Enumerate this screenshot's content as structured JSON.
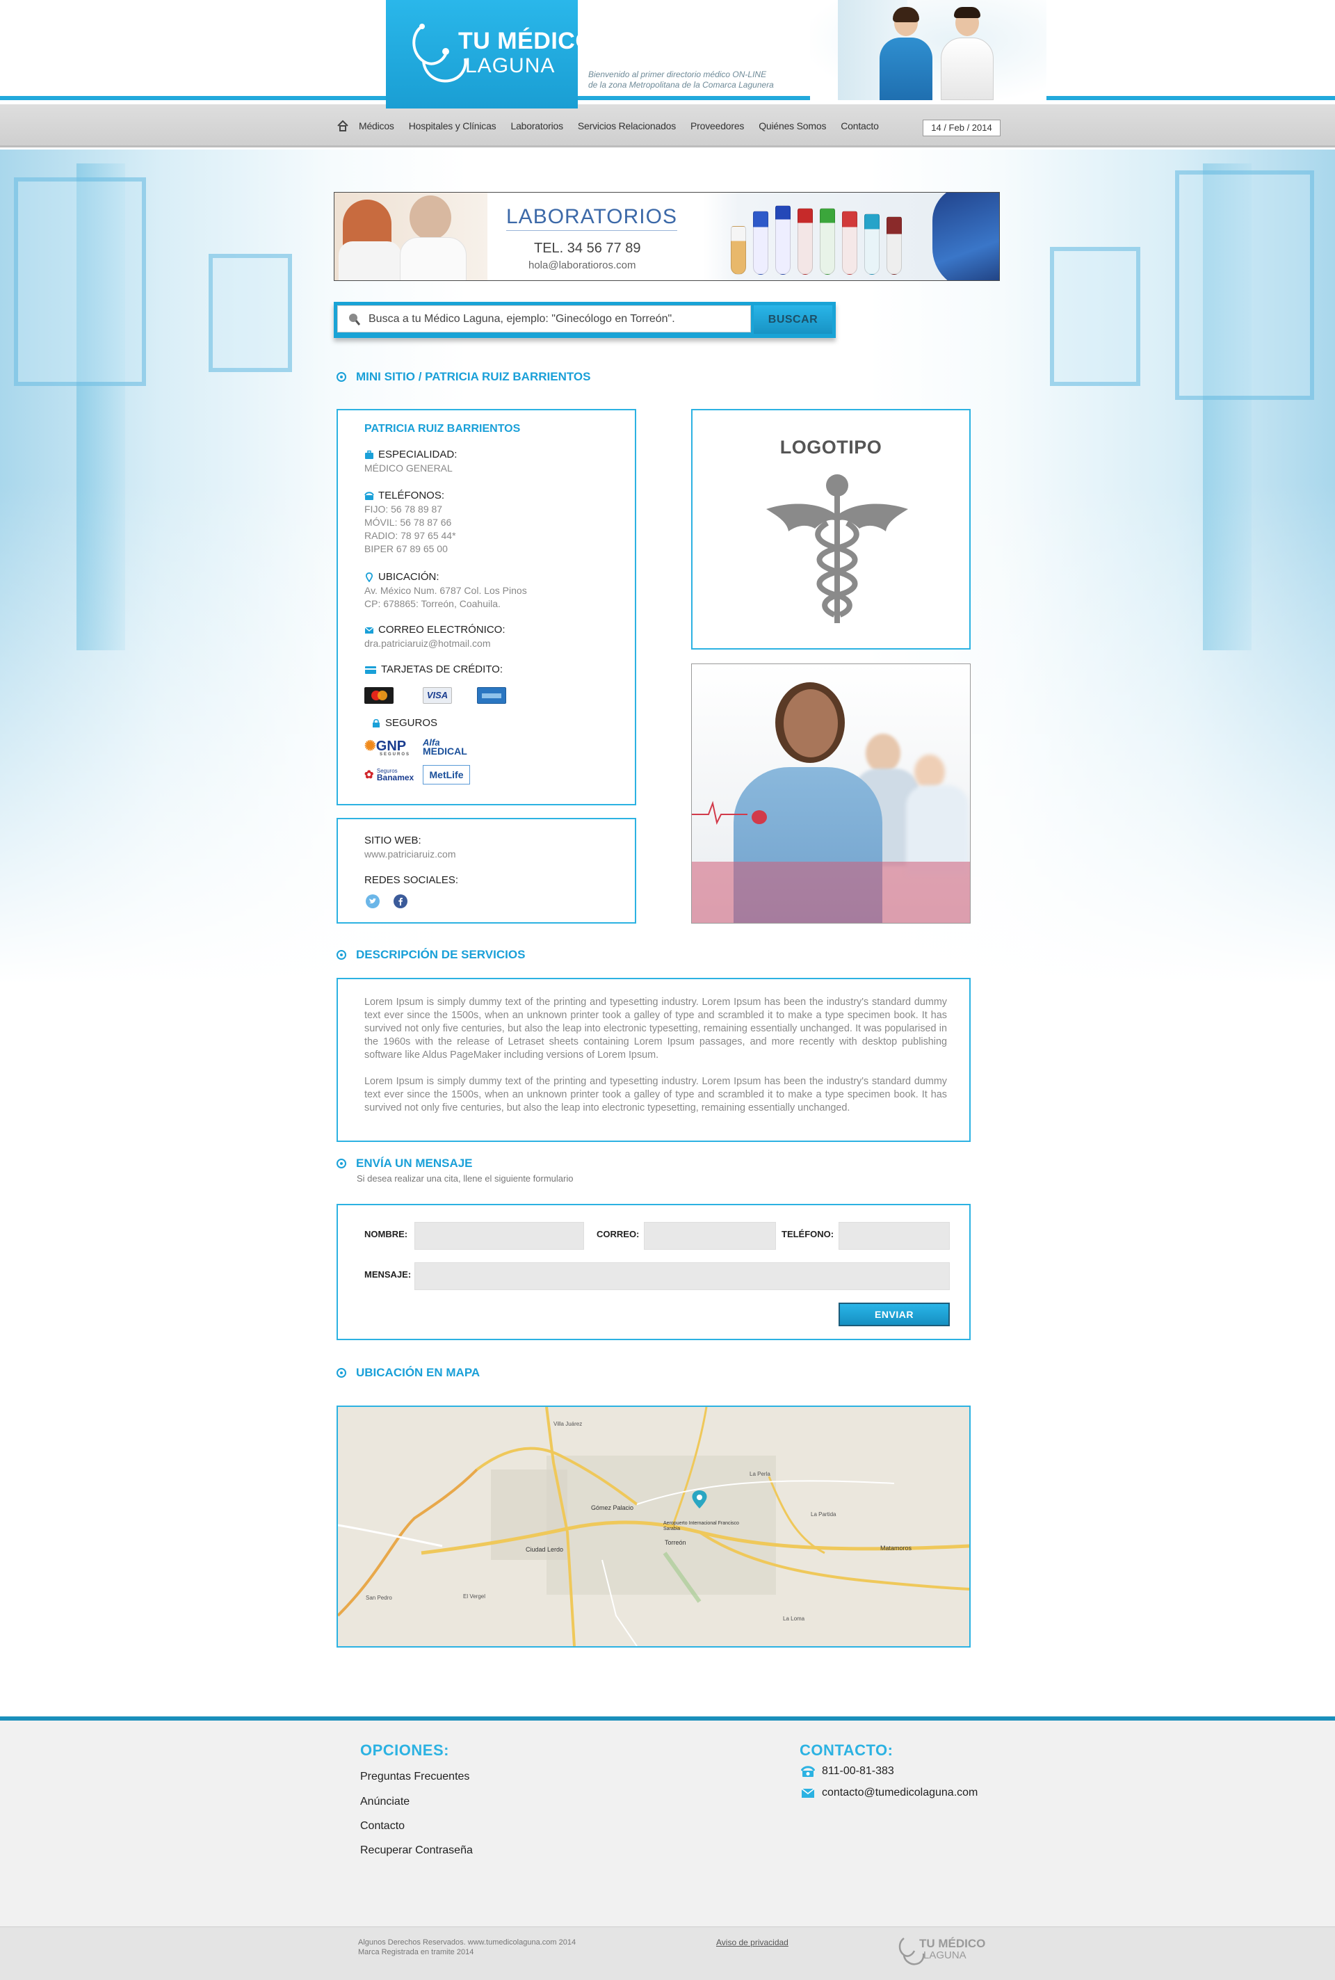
{
  "header": {
    "logo_line1": "TU MÉDICO",
    "logo_line2": "LAGUNA",
    "tagline_line1": "Bienvenido al primer directorio médico ON-LINE",
    "tagline_line2": "de la zona Metropolitana de la Comarca Lagunera",
    "brand_color": "#22a9dc"
  },
  "nav": {
    "home_icon": "home-icon",
    "items": [
      "Médicos",
      "Hospitales y Clínicas",
      "Laboratorios",
      "Servicios Relacionados",
      "Proveedores",
      "Quiénes Somos",
      "Contacto"
    ],
    "date": "14 / Feb / 2014"
  },
  "banner": {
    "title": "LABORATORIOS",
    "tel": "TEL. 34 56 77 89",
    "email": "hola@laboratioros.com"
  },
  "search": {
    "placeholder": "Busca a tu Médico Laguna, ejemplo: \"Ginecólogo en Torreón\".",
    "button": "BUSCAR"
  },
  "minisite": {
    "heading": "MINI SITIO / PATRICIA RUIZ BARRIENTOS",
    "name": "PATRICIA RUIZ BARRIENTOS",
    "specialty_label": "ESPECIALIDAD:",
    "specialty": "MÉDICO GENERAL",
    "phones_label": "TELÉFONOS:",
    "phones": [
      "FIJO: 56 78 89 87",
      "MÓVIL: 56 78 87 66",
      "RADIO: 78 97 65 44*",
      "BIPER 67 89 65 00"
    ],
    "location_label": "UBICACIÓN:",
    "location": [
      "Av. México Num. 6787 Col. Los Pinos",
      "CP: 678865:  Torreón, Coahuila."
    ],
    "email_label": "CORREO ELECTRÓNICO:",
    "email": "dra.patriciaruiz@hotmail.com",
    "cards_label": "TARJETAS DE CRÉDITO:",
    "cards": [
      "MasterCard",
      "VISA",
      "American Express"
    ],
    "insurance_label": "SEGUROS",
    "insurance": [
      "GNP",
      "SEGUROS",
      "Alfa",
      "MEDICAL",
      "Seguros",
      "Banamex",
      "MetLife"
    ],
    "website_label": "SITIO WEB:",
    "website": "www.patriciaruiz.com",
    "social_label": "REDES SOCIALES:",
    "social": [
      "twitter-icon",
      "facebook-icon"
    ],
    "logo_title": "LOGOTIPO"
  },
  "services": {
    "heading": "DESCRIPCIÓN DE SERVICIOS",
    "p1": "Lorem Ipsum is simply dummy text of the printing and typesetting industry. Lorem Ipsum has been the industry's standard dummy text ever since the 1500s, when an unknown printer took a galley of type and scrambled it to make a type specimen book. It has survived not only five centuries, but also the leap into electronic typesetting, remaining essentially unchanged. It was popularised in the 1960s with the release of Letraset sheets containing Lorem Ipsum passages, and more recently with desktop publishing software like Aldus PageMaker including versions of Lorem Ipsum.",
    "p2": "Lorem Ipsum is simply dummy text of the printing and typesetting industry. Lorem Ipsum has been the industry's standard dummy text ever since the 1500s, when an unknown printer took a galley of type and scrambled it to make a type specimen book. It has survived not only five centuries, but also the leap into electronic typesetting, remaining essentially unchanged."
  },
  "message": {
    "heading": "ENVÍA UN MENSAJE",
    "sub": "Si desea realizar una cita, llene el siguiente formulario",
    "name_label": "NOMBRE:",
    "email_label": "CORREO:",
    "phone_label": "TELÉFONO:",
    "message_label": "MENSAJE:",
    "name_value": "",
    "email_value": "",
    "phone_value": "",
    "message_value": "",
    "send": "ENVIAR"
  },
  "map": {
    "heading": "UBICACIÓN EN MAPA",
    "labels": [
      "Gómez Palacio",
      "Ciudad Lerdo",
      "Torreón",
      "Matamoros",
      "Aeropuerto Internacional Francisco Sarabia",
      "La Perla",
      "El Vergel",
      "La Loma",
      "La Partida",
      "San Pedro",
      "Villa Juárez"
    ]
  },
  "footer": {
    "options_heading": "OPCIONES:",
    "options": [
      "Preguntas Frecuentes",
      "Anúnciate",
      "Contacto",
      "Recuperar Contraseña"
    ],
    "contact_heading": "CONTACTO:",
    "phone": "811-00-81-383",
    "email": "contacto@tumedicolaguna.com",
    "copyright_line1": "Algunos Derechos Reservados. www.tumedicolaguna.com 2014",
    "copyright_line2": "Marca Registrada en tramite 2014",
    "privacy": "Aviso de privacidad",
    "logo_line1": "TU MÉDICO",
    "logo_line2": "LAGUNA"
  }
}
